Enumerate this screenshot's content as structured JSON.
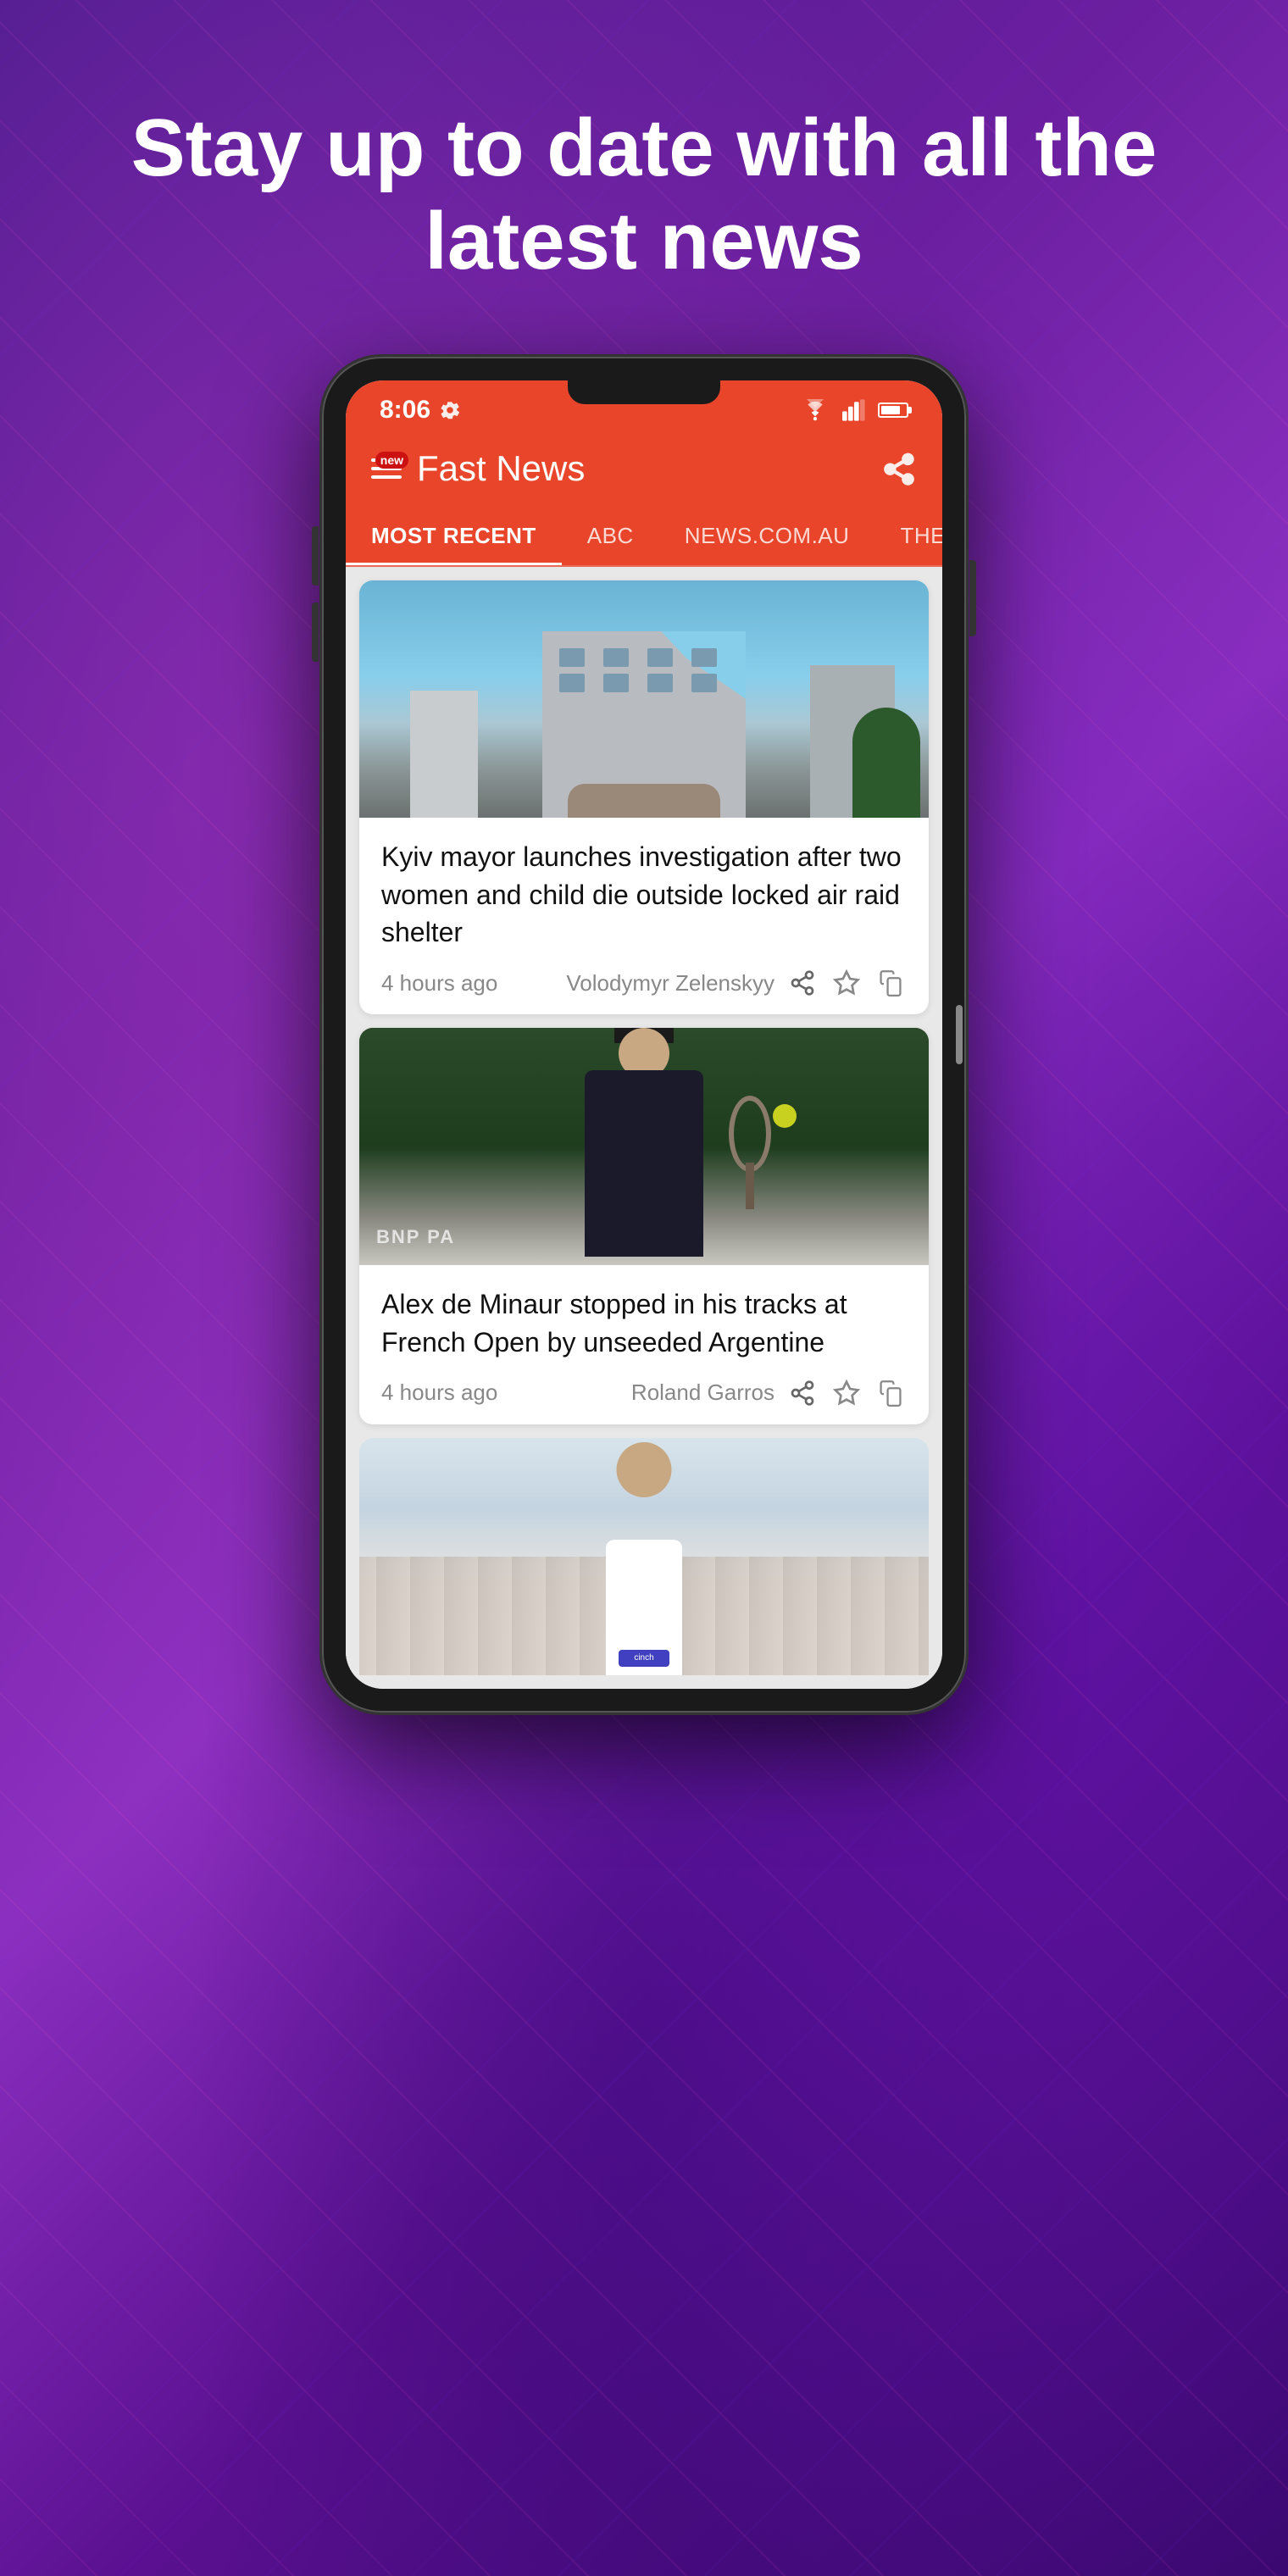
{
  "page": {
    "headline": "Stay up to date with all the latest news",
    "background_color": "#5a1a9a"
  },
  "status_bar": {
    "time": "8:06",
    "gear_icon": "gear",
    "wifi_icon": "wifi",
    "signal_icon": "signal",
    "battery_icon": "battery"
  },
  "app_header": {
    "title": "Fast News",
    "new_badge": "new",
    "menu_icon": "hamburger-menu",
    "share_icon": "share-curved"
  },
  "nav_tabs": [
    {
      "label": "MOST RECENT",
      "active": true
    },
    {
      "label": "ABC",
      "active": false
    },
    {
      "label": "NEWS.COM.AU",
      "active": false
    },
    {
      "label": "THE GUARDIAN AUSTRA…",
      "active": false
    }
  ],
  "news_cards": [
    {
      "id": 1,
      "title": "Kyiv mayor launches investigation after two women and child die outside locked air raid shelter",
      "time": "4 hours ago",
      "source": "Volodymyr Zelenskyy",
      "image_type": "building",
      "actions": [
        "share",
        "star",
        "copy"
      ]
    },
    {
      "id": 2,
      "title": "Alex de Minaur stopped in his tracks at French Open by unseeded Argentine",
      "time": "4 hours ago",
      "source": "Roland Garros",
      "image_type": "tennis",
      "actions": [
        "share",
        "star",
        "copy"
      ]
    },
    {
      "id": 3,
      "title": "",
      "time": "",
      "source": "",
      "image_type": "cricket",
      "actions": []
    }
  ]
}
